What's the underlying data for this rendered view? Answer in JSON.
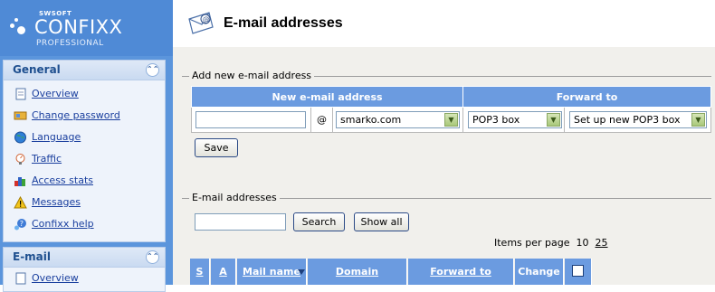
{
  "logo": {
    "brand": "SWSOFT",
    "name": "CONFIXX",
    "edition": "PROFESSIONAL"
  },
  "sidebar": {
    "general": {
      "title": "General",
      "items": [
        {
          "label": "Overview",
          "icon": "document-icon"
        },
        {
          "label": "Change password",
          "icon": "keys-icon"
        },
        {
          "label": "Language",
          "icon": "globe-icon"
        },
        {
          "label": "Traffic",
          "icon": "traffic-gauge-icon"
        },
        {
          "label": "Access stats",
          "icon": "stats-icon"
        },
        {
          "label": "Messages",
          "icon": "warning-icon"
        },
        {
          "label": "Confixx help",
          "icon": "help-icon"
        }
      ]
    },
    "email": {
      "title": "E-mail",
      "items": [
        {
          "label": "Overview",
          "icon": "document-icon"
        }
      ]
    }
  },
  "header": {
    "title": "E-mail addresses",
    "icon": "email-icon"
  },
  "add_form": {
    "legend": "Add new e-mail address",
    "col_new": "New e-mail address",
    "col_forward": "Forward to",
    "address_value": "",
    "at_sign": "@",
    "domain_selected": "smarko.com",
    "forward_type_selected": "POP3 box",
    "forward_target_selected": "Set up new POP3 box",
    "save_label": "Save"
  },
  "list": {
    "legend": "E-mail addresses",
    "search_value": "",
    "search_label": "Search",
    "show_all_label": "Show all",
    "items_per_page_label": "Items per page",
    "ipp_current": "10",
    "ipp_option": "25",
    "columns": {
      "s": "S",
      "a": "A",
      "mail_name": "Mail name",
      "domain": "Domain",
      "forward_to": "Forward to",
      "change": "Change"
    }
  },
  "colors": {
    "sidebar": "#5b95dc",
    "table_header": "#6b9be0",
    "content_bg": "#f1f0ec",
    "link": "#1a3f9e"
  }
}
